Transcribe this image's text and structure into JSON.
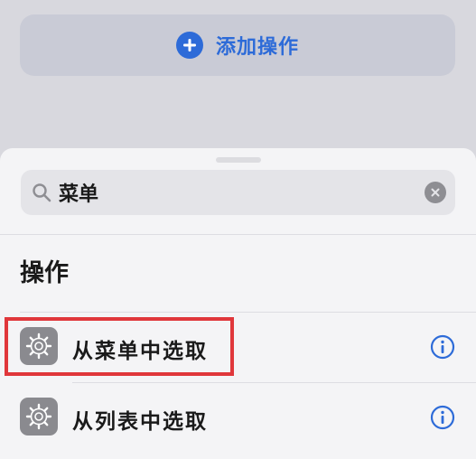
{
  "header": {
    "add_action_label": "添加操作"
  },
  "search": {
    "query": "菜单"
  },
  "section": {
    "title": "操作"
  },
  "actions": [
    {
      "label": "从菜单中选取",
      "icon": "gear-icon",
      "highlighted": true
    },
    {
      "label": "从列表中选取",
      "icon": "gear-icon",
      "highlighted": false
    }
  ],
  "colors": {
    "accent": "#2d6bd8",
    "highlight": "#e0373b",
    "action_icon_bg": "#8a8a8f"
  }
}
